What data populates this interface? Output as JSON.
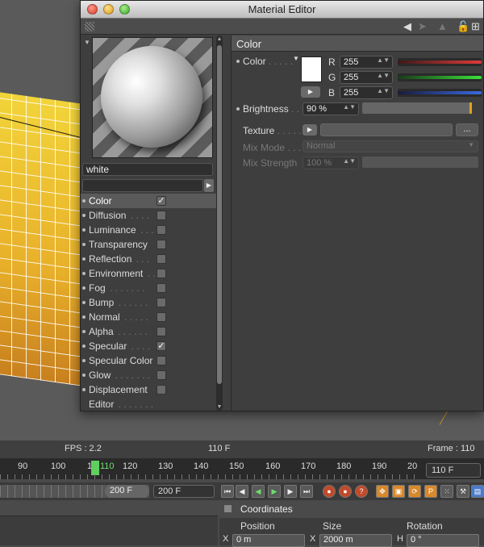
{
  "window": {
    "title": "Material Editor"
  },
  "material": {
    "name": "white"
  },
  "channels": [
    {
      "label": "Color",
      "dots": "",
      "checked": true,
      "active": true
    },
    {
      "label": "Diffusion",
      "dots": ". . . .",
      "checked": false
    },
    {
      "label": "Luminance",
      "dots": ". . .",
      "checked": false
    },
    {
      "label": "Transparency",
      "dots": "",
      "checked": false
    },
    {
      "label": "Reflection",
      "dots": ". . .",
      "checked": false
    },
    {
      "label": "Environment",
      "dots": ". .",
      "checked": false
    },
    {
      "label": "Fog",
      "dots": ". . . . . . .",
      "checked": false
    },
    {
      "label": "Bump",
      "dots": ". . . . . .",
      "checked": false
    },
    {
      "label": "Normal",
      "dots": ". . . . .",
      "checked": false
    },
    {
      "label": "Alpha",
      "dots": ". . . . . .",
      "checked": false
    },
    {
      "label": "Specular",
      "dots": ". . . .",
      "checked": true
    },
    {
      "label": "Specular Color",
      "dots": "",
      "checked": false
    },
    {
      "label": "Glow",
      "dots": ". . . . . . .",
      "checked": false
    },
    {
      "label": "Displacement",
      "dots": "",
      "checked": false
    },
    {
      "label": "Editor",
      "dots": ". . . . . . .",
      "checked": null
    }
  ],
  "color_panel": {
    "section_title": "Color",
    "color_label": "Color",
    "color_dots": ". . . . .",
    "swatch_color": "#ffffff",
    "r_label": "R",
    "r_value": "255",
    "g_label": "G",
    "g_value": "255",
    "b_label": "B",
    "b_value": "255",
    "brightness_label": "Brightness",
    "brightness_dots": ". . .",
    "brightness_value": "90 %",
    "texture_label": "Texture",
    "texture_dots": ". . . . . . .",
    "texture_more": "...",
    "mix_mode_label": "Mix Mode",
    "mix_mode_dots": ". . . . .",
    "mix_mode_value": "Normal",
    "mix_strength_label": "Mix Strength",
    "mix_strength_value": "100 %"
  },
  "status": {
    "fps": "FPS : 2.2",
    "frame_center": "110 F",
    "frame_right": "Frame : 110"
  },
  "timeline": {
    "ticks": [
      "90",
      "100",
      "1",
      "120",
      "130",
      "140",
      "150",
      "160",
      "170",
      "180",
      "190",
      "20"
    ],
    "current": "110",
    "current_frame_field": "110 F",
    "min_field": "200 F",
    "max_field": "200 F"
  },
  "coordinates": {
    "title": "Coordinates",
    "col_position": "Position",
    "col_size": "Size",
    "col_rotation": "Rotation",
    "x_label": "X",
    "x_pos": "0 m",
    "x2_label": "X",
    "x_size": "2000 m",
    "h_label": "H",
    "h_rot": "0 °"
  }
}
